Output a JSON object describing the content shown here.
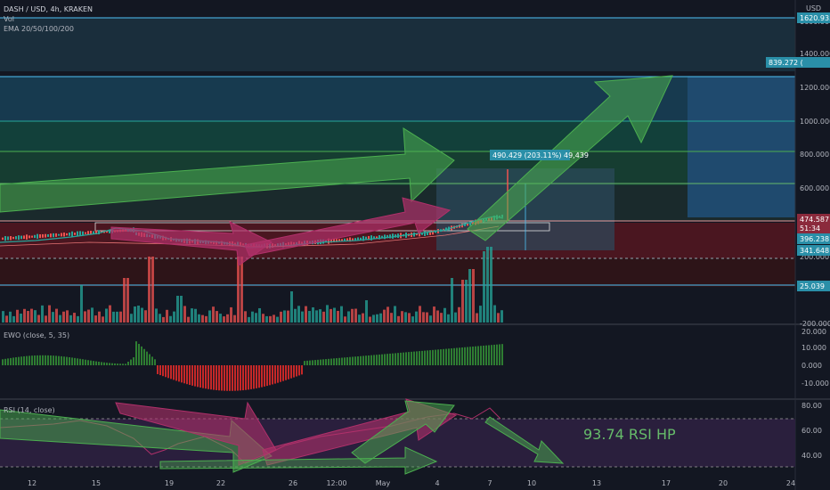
{
  "header": {
    "symbol": "DASH / USD, 4h, KRAKEN",
    "vol_label": "Vol",
    "ema_label": "EMA 20/50/100/200"
  },
  "currency": "USD",
  "price_axis": {
    "ticks": [
      "1600.000",
      "1400.000",
      "1200.000",
      "1000.000",
      "800.000",
      "600.000",
      "400.000",
      "200.000",
      "-200.000"
    ],
    "tags": [
      {
        "text": "1620.935",
        "color": "#2a8fa8"
      },
      {
        "text": "839.272 (",
        "color": "#2a8fa8"
      },
      {
        "text": "474.587",
        "color": "#8b2a3c"
      },
      {
        "text": "51:34",
        "color": "#8b2a3c"
      },
      {
        "text": "396.238",
        "color": "#2a8fa8"
      },
      {
        "text": "341.648",
        "color": "#2a8fa8"
      },
      {
        "text": "25.039",
        "color": "#2a8fa8"
      }
    ]
  },
  "measure_label": "490.429 (203.11%) 49,439",
  "ewo": {
    "label": "EWO (close, 5, 35)",
    "ticks": [
      "20.000",
      "10.000",
      "0.000",
      "-10.000"
    ]
  },
  "rsi": {
    "label": "RSI (14, close)",
    "ticks": [
      "80.00",
      "60.00",
      "40.00"
    ],
    "annotation": "93.74 RSI HP"
  },
  "time_axis": {
    "ticks": [
      "12",
      "15",
      "19",
      "22",
      "26",
      "12:00",
      "May",
      "4",
      "7",
      "10",
      "13",
      "17",
      "20",
      "24"
    ]
  },
  "colors": {
    "background": "#131722",
    "up": "#26a69a",
    "down": "#ef5350",
    "arrow_green": "#4caf50",
    "arrow_pink": "#b0306a",
    "rsi_band": "#2a1f3d"
  },
  "chart_data": [
    {
      "type": "line",
      "title": "DASH / USD, 4h, KRAKEN",
      "xlabel": "",
      "ylabel": "USD",
      "x": [
        "12",
        "15",
        "19",
        "22",
        "26",
        "12:00",
        "May",
        "4",
        "7",
        "10"
      ],
      "series": [
        {
          "values": [
            250,
            320,
            280,
            230,
            260,
            300,
            320,
            380,
            470,
            474
          ]
        }
      ],
      "ylim": [
        -200,
        1650
      ],
      "levels": [
        1620.935,
        839.272,
        474.587,
        396.238,
        341.648,
        25.039
      ]
    },
    {
      "type": "bar",
      "title": "EWO (close, 5, 35)",
      "ylim": [
        -15,
        20
      ]
    },
    {
      "type": "line",
      "title": "RSI (14, close)",
      "ylim": [
        30,
        90
      ],
      "bands": [
        70,
        30
      ]
    }
  ]
}
